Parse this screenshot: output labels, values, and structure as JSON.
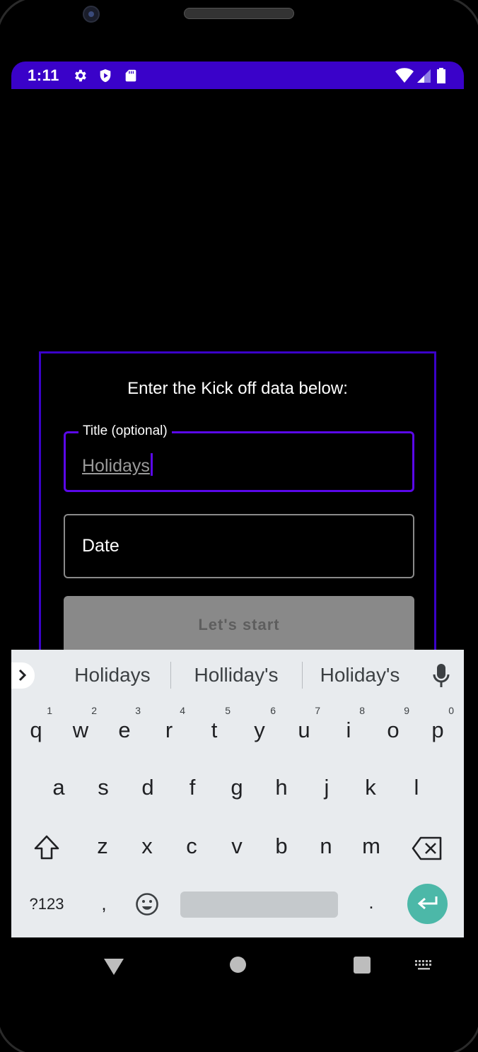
{
  "status_bar": {
    "time": "1:11",
    "icons": [
      "gear-icon",
      "shield-play-icon",
      "sd-card-icon",
      "wifi-icon",
      "signal-icon",
      "battery-icon"
    ],
    "color": "#3a02c9"
  },
  "dialog": {
    "heading": "Enter the Kick off data below:",
    "title_field": {
      "label": "Title (optional)",
      "value": "Holidays"
    },
    "date_field": {
      "label": "Date"
    },
    "start_button": {
      "label": "Let's start"
    },
    "accent_color": "#5a08e8"
  },
  "keyboard": {
    "suggestions": [
      "Holidays",
      "Holliday's",
      "Holiday's"
    ],
    "row1": [
      {
        "key": "q",
        "hint": "1"
      },
      {
        "key": "w",
        "hint": "2"
      },
      {
        "key": "e",
        "hint": "3"
      },
      {
        "key": "r",
        "hint": "4"
      },
      {
        "key": "t",
        "hint": "5"
      },
      {
        "key": "y",
        "hint": "6"
      },
      {
        "key": "u",
        "hint": "7"
      },
      {
        "key": "i",
        "hint": "8"
      },
      {
        "key": "o",
        "hint": "9"
      },
      {
        "key": "p",
        "hint": "0"
      }
    ],
    "row2": [
      "a",
      "s",
      "d",
      "f",
      "g",
      "h",
      "j",
      "k",
      "l"
    ],
    "row3": [
      "z",
      "x",
      "c",
      "v",
      "b",
      "n",
      "m"
    ],
    "row4": {
      "symbols_label": "?123",
      "comma": ",",
      "period": "."
    },
    "enter_color": "#4cb8a8"
  },
  "nav_bar": {
    "icons": [
      "back-icon",
      "home-icon",
      "recents-icon",
      "keyboard-switch-icon"
    ]
  }
}
